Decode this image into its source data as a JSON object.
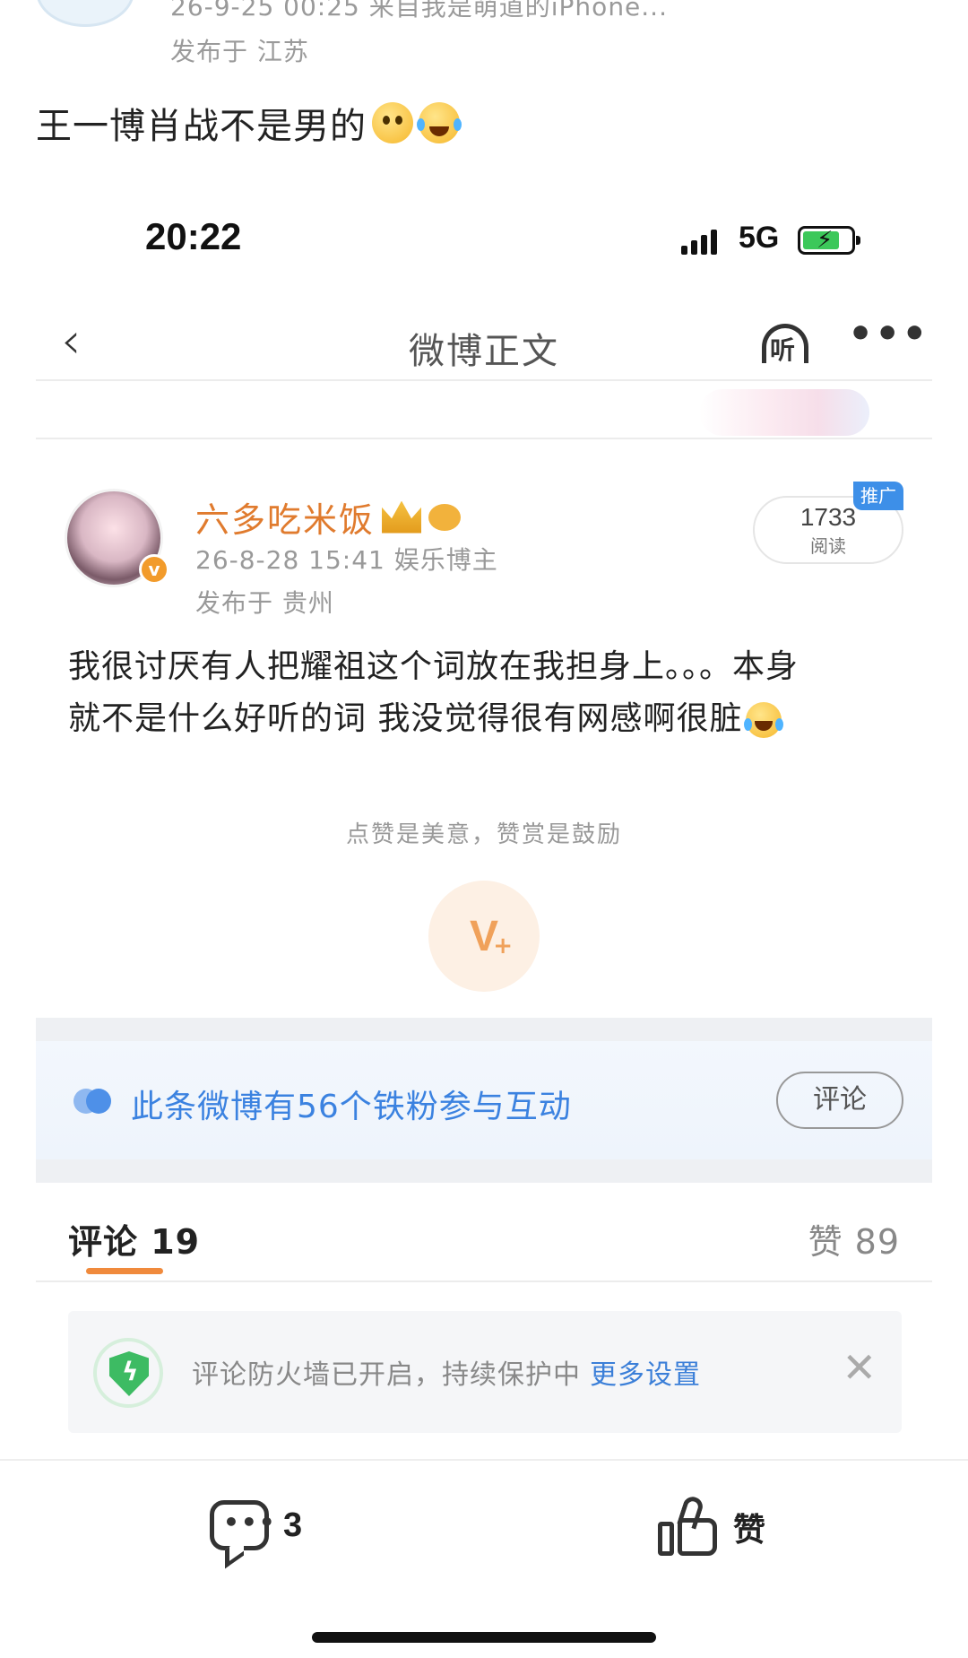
{
  "repost": {
    "meta": "26-9-25 00:25  来自我是萌道的iPhone...",
    "location": "发布于 江苏",
    "text": "王一博肖战不是男的"
  },
  "status_bar": {
    "time": "20:22",
    "network": "5G"
  },
  "nav": {
    "back": "‹",
    "title": "微博正文",
    "listen": "听",
    "more": "•••"
  },
  "post": {
    "username": "六多吃米饭",
    "time_and_tag": "26-8-28 15:41  娱乐博主",
    "location": "发布于 贵州",
    "reads_count": "1733",
    "reads_label": "阅读",
    "promo_tag": "推广",
    "body_lines": [
      "我很讨厌有人把耀祖这个词放在我担身上。。。本身",
      "就不是什么好听的词 我没觉得很有网感啊很脏"
    ]
  },
  "reward": {
    "hint": "点赞是美意，赞赏是鼓励"
  },
  "fans": {
    "text": "此条微博有56个铁粉参与互动",
    "button": "评论"
  },
  "tabs": {
    "comments": "评论 19",
    "likes": "赞 89"
  },
  "firewall": {
    "text": "评论防火墙已开启，持续保护中",
    "link": "更多设置"
  },
  "bottom_bar": {
    "comment_count": "3",
    "like_label": "赞"
  },
  "colors": {
    "username": "#e07b2e",
    "fans_text": "#3b82e0",
    "tab_underline": "#f08a3c",
    "shield": "#3dbb63",
    "promo_tag": "#3d8fe8"
  },
  "icons": [
    "emoji-thinking-icon",
    "emoji-laugh-cry-icon",
    "signal-icon",
    "battery-icon",
    "back-icon",
    "listen-headphone-icon",
    "more-icon",
    "crown-badge-icon",
    "fish-badge-icon",
    "verified-badge-icon",
    "reward-icon",
    "fans-icon",
    "shield-icon",
    "close-icon",
    "comment-bubble-icon",
    "thumbs-up-icon"
  ]
}
